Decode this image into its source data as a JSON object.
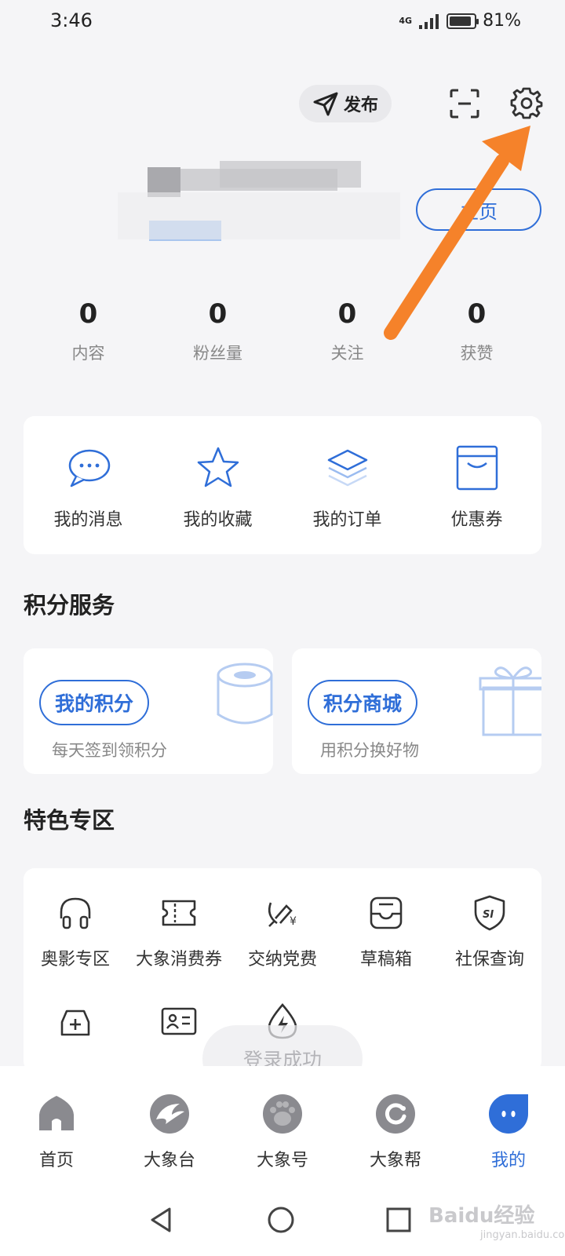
{
  "status_bar": {
    "time": "3:46",
    "network": "4G",
    "battery": "81%",
    "battery_level": 0.81
  },
  "header": {
    "publish_label": "发布"
  },
  "profile": {
    "homepage_label": "主页"
  },
  "stats": [
    {
      "value": "0",
      "label": "内容"
    },
    {
      "value": "0",
      "label": "粉丝量"
    },
    {
      "value": "0",
      "label": "关注"
    },
    {
      "value": "0",
      "label": "获赞"
    }
  ],
  "quick_actions": [
    {
      "label": "我的消息",
      "icon": "chat-bubble-icon"
    },
    {
      "label": "我的收藏",
      "icon": "star-icon"
    },
    {
      "label": "我的订单",
      "icon": "layers-icon"
    },
    {
      "label": "优惠券",
      "icon": "coupon-icon"
    }
  ],
  "points_section": {
    "title": "积分服务",
    "cards": [
      {
        "label": "我的积分",
        "subtitle": "每天签到领积分",
        "icon": "coins-icon"
      },
      {
        "label": "积分商城",
        "subtitle": "用积分换好物",
        "icon": "gift-icon"
      }
    ]
  },
  "special_section": {
    "title": "特色专区",
    "items": [
      {
        "label": "奥影专区",
        "icon": "headphones-icon"
      },
      {
        "label": "大象消费券",
        "icon": "ticket-icon"
      },
      {
        "label": "交纳党费",
        "icon": "party-emblem-icon"
      },
      {
        "label": "草稿箱",
        "icon": "inbox-icon"
      },
      {
        "label": "社保查询",
        "icon": "social-security-shield-icon"
      },
      {
        "label": "",
        "icon": "car-plus-icon"
      },
      {
        "label": "",
        "icon": "id-card-icon"
      },
      {
        "label": "",
        "icon": "water-drop-bolt-icon"
      }
    ]
  },
  "toast": {
    "text": "登录成功"
  },
  "tab_bar": [
    {
      "label": "首页",
      "icon": "home-icon",
      "active": false
    },
    {
      "label": "大象台",
      "icon": "elephant-station-icon",
      "active": false
    },
    {
      "label": "大象号",
      "icon": "paw-icon",
      "active": false
    },
    {
      "label": "大象帮",
      "icon": "help-circle-icon",
      "active": false
    },
    {
      "label": "我的",
      "icon": "profile-face-icon",
      "active": true
    }
  ],
  "watermark": {
    "brand": "Baidu经验",
    "url": "jingyan.baidu.com"
  },
  "colors": {
    "accent": "#2f6ed8",
    "annotation_arrow": "#f5822a",
    "tab_inactive_icon": "#8a8a8f"
  }
}
